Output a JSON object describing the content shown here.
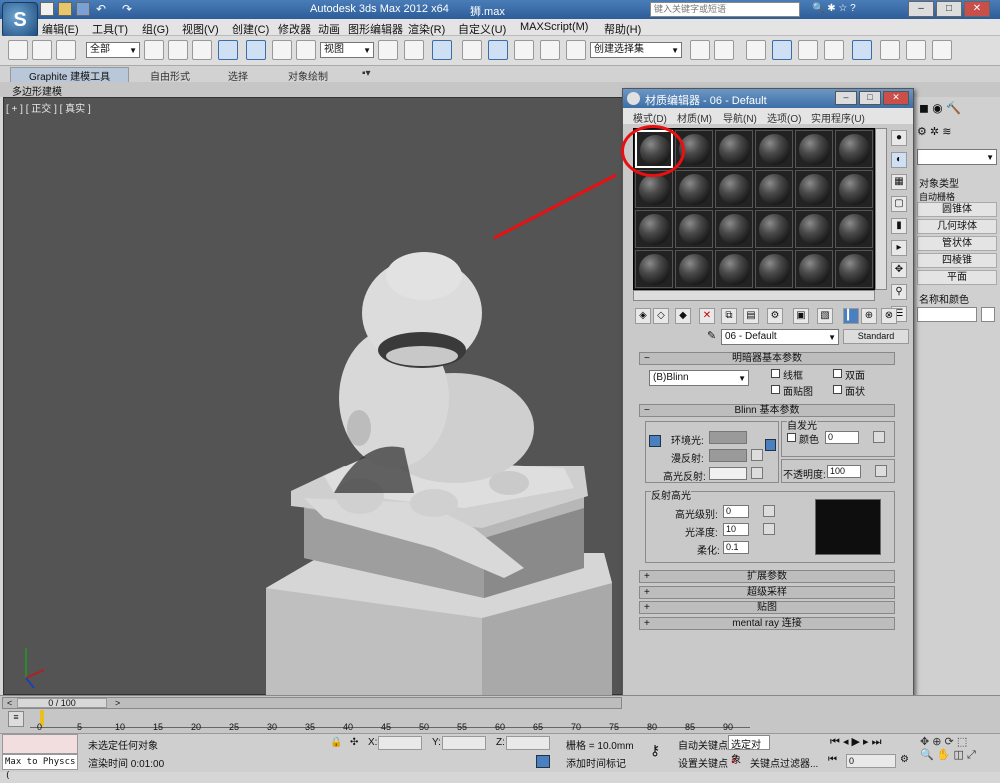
{
  "app": {
    "title": "Autodesk 3ds Max  2012 x64",
    "file": "狮.max",
    "search_placeholder": "键入关键字或短语",
    "logo": "S"
  },
  "menu": [
    "编辑(E)",
    "工具(T)",
    "组(G)",
    "视图(V)",
    "创建(C)",
    "修改器",
    "动画",
    "图形编辑器",
    "渲染(R)",
    "自定义(U)",
    "MAXScript(M)",
    "帮助(H)"
  ],
  "toolbar": {
    "selection_filter": "全部",
    "reference_coord": "视图",
    "named_selection": "创建选择集"
  },
  "ribbon": {
    "tabs": [
      "Graphite 建模工具",
      "自由形式",
      "选择",
      "对象绘制"
    ],
    "sub": "多边形建模"
  },
  "viewport": {
    "label": "[ + ] [ 正交 ] [ 真实 ]"
  },
  "material_editor": {
    "title": "材质编辑器 - 06 - Default",
    "menu": [
      "模式(D)",
      "材质(M)",
      "导航(N)",
      "选项(O)",
      "实用程序(U)"
    ],
    "material_name": "06 - Default",
    "material_type": "Standard",
    "shader_rollout": "明暗器基本参数",
    "shader": "(B)Blinn",
    "shader_options": [
      "线框",
      "双面",
      "面贴图",
      "面状"
    ],
    "blinn_rollout": "Blinn 基本参数",
    "self_illum": {
      "label": "自发光",
      "color_label": "颜色",
      "value": "0"
    },
    "ambient": "环境光:",
    "diffuse": "漫反射:",
    "specular": "高光反射:",
    "opacity_label": "不透明度:",
    "opacity": "100",
    "spec_highlights": {
      "label": "反射高光",
      "level_label": "高光级别:",
      "level": "0",
      "gloss_label": "光泽度:",
      "gloss": "10",
      "soften_label": "柔化:",
      "soften": "0.1"
    },
    "rollouts": [
      "扩展参数",
      "超级采样",
      "贴图",
      "mental ray 连接"
    ]
  },
  "command_panel": {
    "section": "对象类型",
    "autogrid": "自动栅格",
    "buttons": [
      "圆锥体",
      "几何球体",
      "管状体",
      "四棱锥",
      "平面"
    ],
    "name_color": "名称和颜色"
  },
  "timeline": {
    "frame": "0 / 100",
    "ticks": [
      "0",
      "5",
      "10",
      "15",
      "20",
      "25",
      "30",
      "35",
      "40",
      "45",
      "50",
      "55",
      "60",
      "65",
      "70",
      "75",
      "80",
      "85",
      "90"
    ]
  },
  "status": {
    "listener": "Max to Physcs (",
    "selection": "未选定任何对象",
    "render_time": "渲染时间  0:01:00",
    "x_label": "X:",
    "y_label": "Y:",
    "z_label": "Z:",
    "grid": "栅格 = 10.0mm",
    "add_time_tag": "添加时间标记",
    "auto_key": "自动关键点",
    "selected": "选定对象",
    "set_key": "设置关键点",
    "key_filters": "关键点过滤器...",
    "frame_field": "0"
  },
  "colors": {
    "viewport_bg": "#545454",
    "selection_circle": "#e81010",
    "title_blue": "#2d5d99"
  }
}
